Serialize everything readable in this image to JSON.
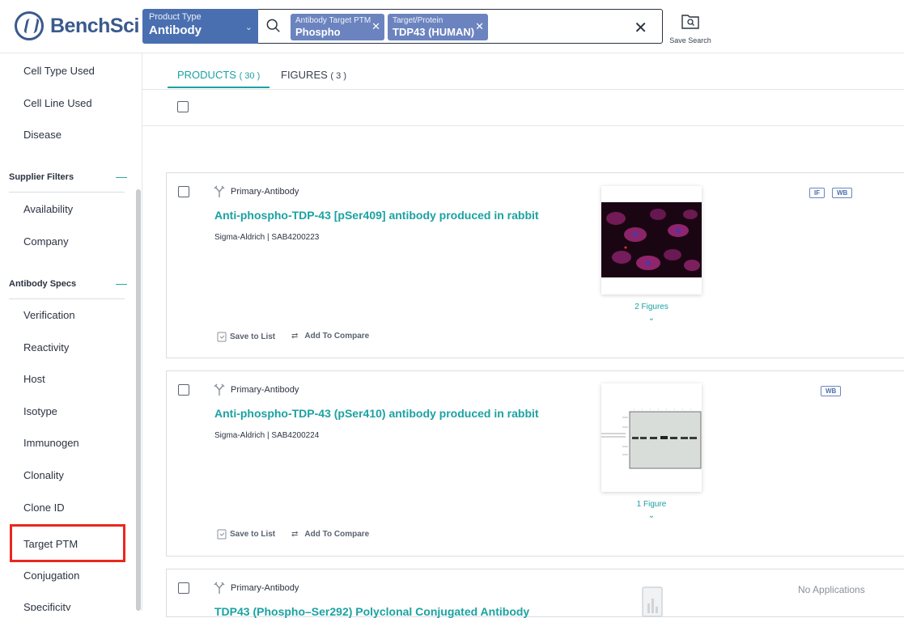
{
  "header": {
    "logo_text": "BenchSci",
    "product_type_label": "Product Type",
    "product_type_value": "Antibody",
    "chips": [
      {
        "label": "Antibody Target PTM",
        "value": "Phospho"
      },
      {
        "label": "Target/Protein",
        "value": "TDP43 (HUMAN)"
      }
    ],
    "save_search_label": "Save Search"
  },
  "sidebar": {
    "items_top": [
      "Cell Type Used",
      "Cell Line Used",
      "Disease"
    ],
    "supplier_filters_heading": "Supplier Filters",
    "supplier_items": [
      "Availability",
      "Company"
    ],
    "antibody_specs_heading": "Antibody Specs",
    "antibody_items": [
      "Verification",
      "Reactivity",
      "Host",
      "Isotype",
      "Immunogen",
      "Clonality",
      "Clone ID",
      "Target PTM",
      "Conjugation",
      "Specificity"
    ],
    "collapse_glyph": "—"
  },
  "tabs": [
    {
      "label": "PRODUCTS",
      "count": "( 30 )"
    },
    {
      "label": "FIGURES",
      "count": "( 3 )"
    }
  ],
  "results": [
    {
      "product_type": "Primary-Antibody",
      "title": "Anti-phospho-TDP-43 [pSer409] antibody produced in rabbit",
      "supplier": "Sigma-Aldrich | SAB4200223",
      "figures_link": "2 Figures",
      "badges": [
        "IF",
        "WB"
      ],
      "save_label": "Save to List",
      "compare_label": "Add To Compare"
    },
    {
      "product_type": "Primary-Antibody",
      "title": "Anti-phospho-TDP-43 (pSer410) antibody produced in rabbit",
      "supplier": "Sigma-Aldrich | SAB4200224",
      "figures_link": "1 Figure",
      "badges": [
        "WB"
      ],
      "save_label": "Save to List",
      "compare_label": "Add To Compare"
    },
    {
      "product_type": "Primary-Antibody",
      "title": "TDP43 (Phospho–Ser292) Polyclonal Conjugated Antibody",
      "no_applications": "No Applications"
    }
  ],
  "colors": {
    "accent_teal": "#1ba2a2",
    "brand_blue": "#4a6fb0",
    "highlight_red": "#e8281e"
  }
}
